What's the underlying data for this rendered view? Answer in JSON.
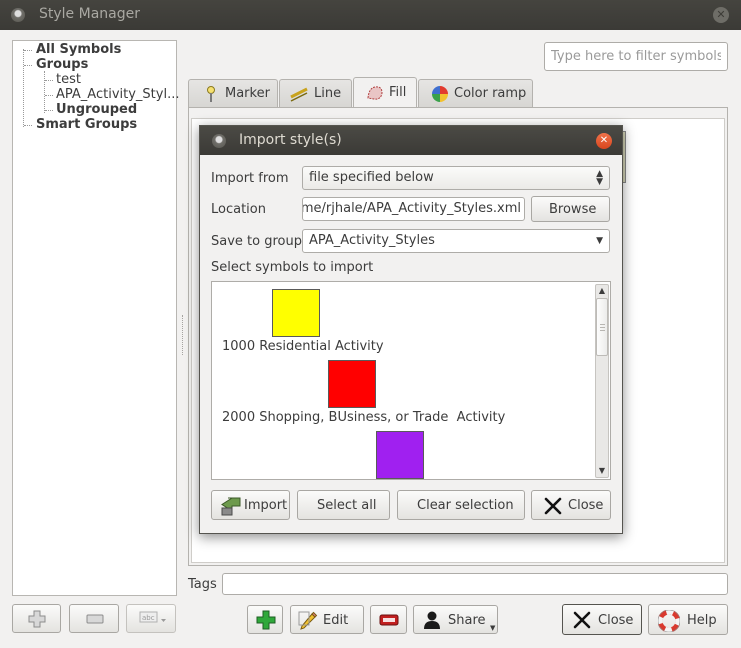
{
  "main_window": {
    "title": "Style Manager",
    "tree": {
      "all_symbols": "All Symbols",
      "groups": "Groups",
      "group_items": [
        "test",
        "APA_Activity_Styl..."
      ],
      "ungrouped": "Ungrouped",
      "smart_groups": "Smart Groups"
    },
    "filter_placeholder": "Type here to filter symbols...",
    "tabs": [
      "Marker",
      "Line",
      "Fill",
      "Color ramp"
    ],
    "active_tab": "Fill",
    "tags_label": "Tags",
    "buttons": {
      "edit": "Edit",
      "share": "Share",
      "close": "Close",
      "help": "Help"
    },
    "fill_swatch_colors": [
      "#e4e4e4",
      "#d7cf9e",
      "#8aa9d1",
      "#d8d1a3",
      "#8aad4f",
      "#d6d6b8"
    ]
  },
  "import_dialog": {
    "title": "Import style(s)",
    "import_from_label": "Import from",
    "import_from_value": "file specified below",
    "location_label": "Location",
    "location_value": "home/rjhale/APA_Activity_Styles.xml",
    "browse_button": "Browse",
    "save_to_group_label": "Save to group",
    "save_to_group_value": "APA_Activity_Styles",
    "select_symbols_label": "Select symbols to import",
    "symbols": [
      {
        "name": "1000 Residential Activity",
        "color": "#ffff00"
      },
      {
        "name": "2000 Shopping, BUsiness, or Trade  Activity",
        "color": "#ff0000"
      },
      {
        "name": "",
        "color": "#a020f0"
      }
    ],
    "buttons": {
      "import": "Import",
      "select_all": "Select all",
      "clear_selection": "Clear selection",
      "close": "Close"
    }
  }
}
